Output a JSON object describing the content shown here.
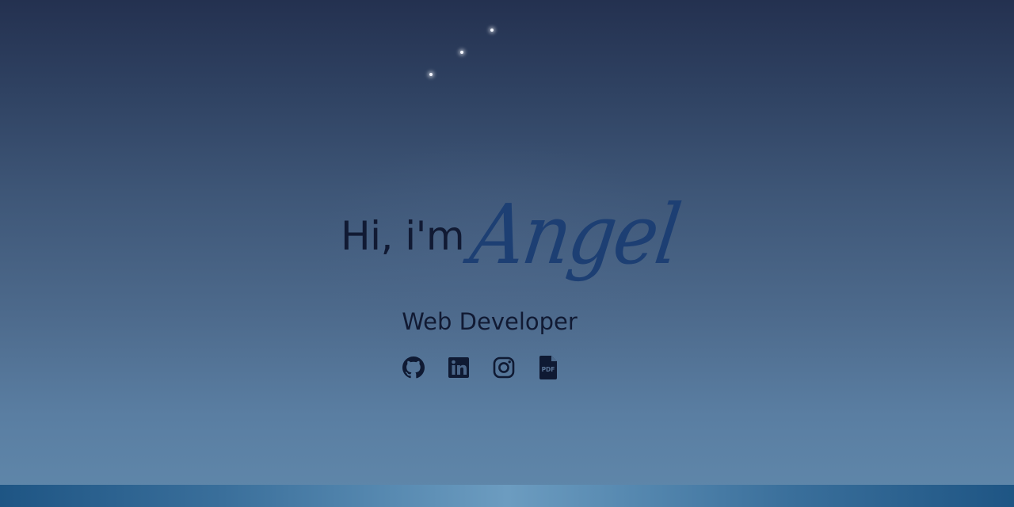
{
  "hero": {
    "greeting": "Hi, i'm",
    "name": "Angel",
    "subtitle": "Web Developer"
  },
  "social": [
    {
      "icon": "github-icon",
      "label": "GitHub"
    },
    {
      "icon": "linkedin-icon",
      "label": "LinkedIn"
    },
    {
      "icon": "instagram-icon",
      "label": "Instagram"
    },
    {
      "icon": "pdf-icon",
      "label": "PDF"
    }
  ],
  "colors": {
    "text": "#111a33",
    "accent": "#1d3f73",
    "background_top": "#243150",
    "background_bottom": "#6088ab"
  }
}
